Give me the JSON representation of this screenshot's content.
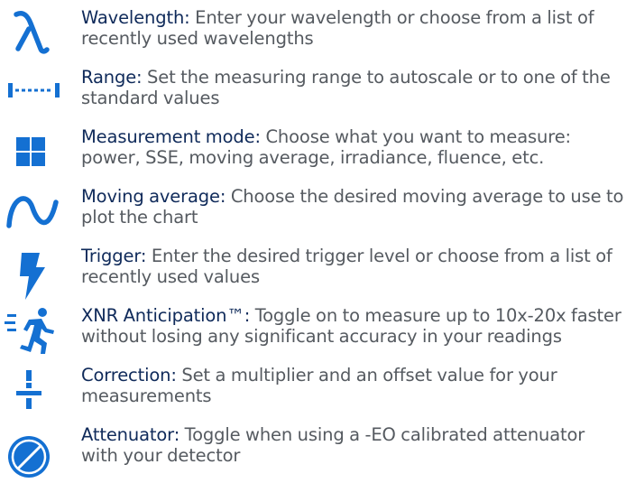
{
  "accent_color": "#1470d2",
  "label_color": "#0f2a5a",
  "description_color": "#555a60",
  "items": [
    {
      "icon": "lambda-icon",
      "label": "Wavelength:",
      "description": " Enter your wavelength or choose from a list of recently used wavelengths"
    },
    {
      "icon": "range-icon",
      "label": "Range:",
      "description": " Set the measuring range to autoscale or to one of the standard values"
    },
    {
      "icon": "grid-icon",
      "label": "Measurement mode:",
      "description": " Choose what you want to measure: power, SSE, moving average, irradiance, fluence, etc."
    },
    {
      "icon": "sine-wave-icon",
      "label": "Moving average:",
      "description": " Choose the desired moving average to use to plot the chart"
    },
    {
      "icon": "lightning-icon",
      "label": "Trigger:",
      "description": " Enter the desired trigger level or choose from a list of recently used values"
    },
    {
      "icon": "running-person-icon",
      "label": "XNR Anticipation™:",
      "description": " Toggle on to measure up to 10x-20x faster without losing any significant accuracy in your readings"
    },
    {
      "icon": "correction-icon",
      "label": "Correction:",
      "description": " Set a multiplier and an offset value for your measurements"
    },
    {
      "icon": "attenuator-icon",
      "label": "Attenuator:",
      "description": " Toggle when using a -EO calibrated attenuator with your detector"
    }
  ]
}
